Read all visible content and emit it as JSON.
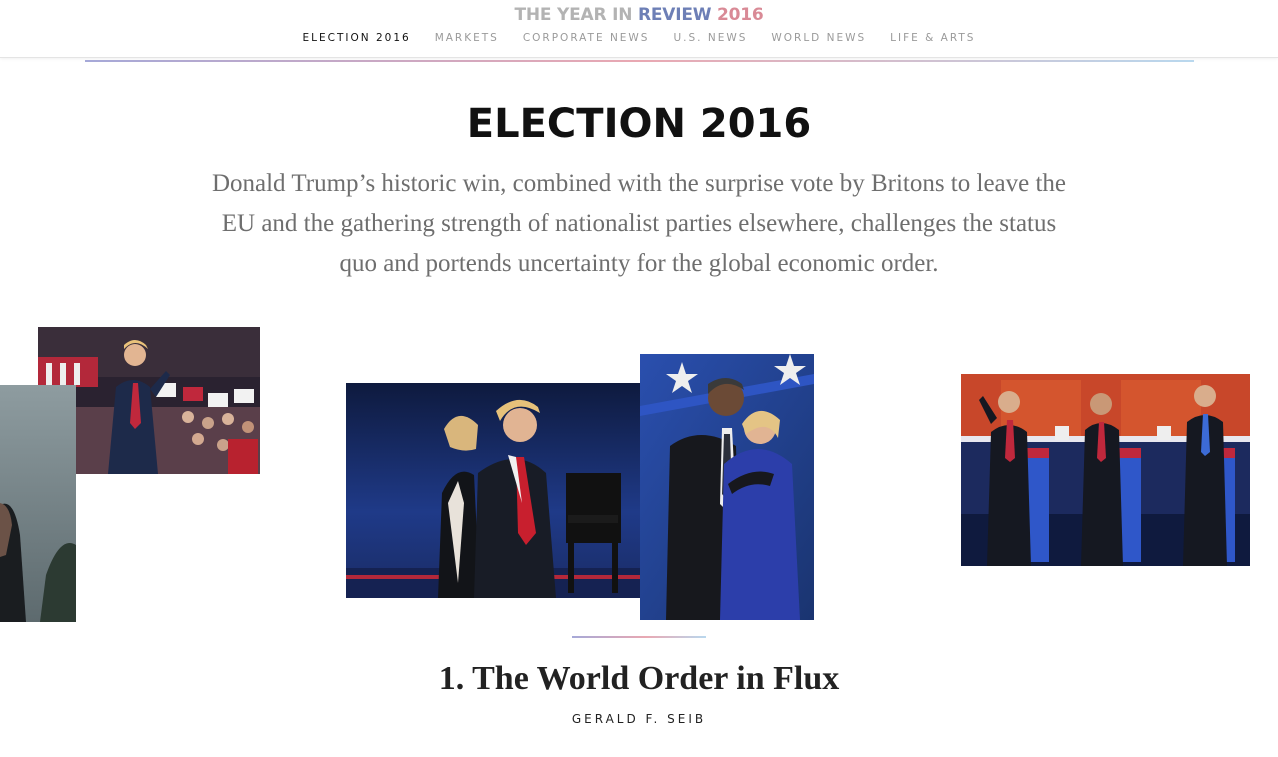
{
  "brand": {
    "part1": "THE YEAR IN ",
    "part2": "REVIEW ",
    "part3": "2016"
  },
  "nav": {
    "items": [
      {
        "label": "ELECTION 2016",
        "active": true
      },
      {
        "label": "MARKETS",
        "active": false
      },
      {
        "label": "CORPORATE NEWS",
        "active": false
      },
      {
        "label": "U.S. NEWS",
        "active": false
      },
      {
        "label": "WORLD NEWS",
        "active": false
      },
      {
        "label": "LIFE & ARTS",
        "active": false
      }
    ]
  },
  "section": {
    "title": "ELECTION 2016",
    "dek": "Donald Trump’s historic win, combined with the surprise vote by Britons to leave the EU and the gathering strength of nationalist parties elsewhere, challenges the status quo and portends uncertainty for the global economic order."
  },
  "article": {
    "title": "1. The World Order in Flux",
    "byline": "GERALD F. SEIB"
  },
  "colors": {
    "accent_blue": "#6d7fb6",
    "accent_pink": "#d98a96",
    "nav_inactive": "#9a9a9a",
    "dek_gray": "#6e6e6e"
  }
}
